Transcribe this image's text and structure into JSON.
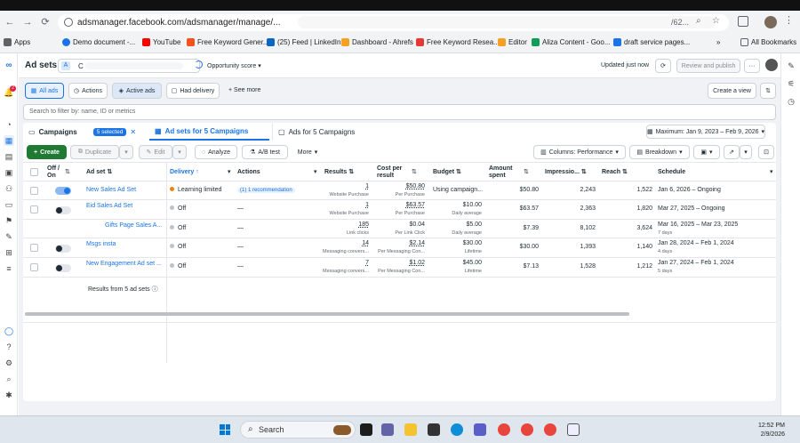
{
  "browser": {
    "url": "adsmanager.facebook.com/adsmanager/manage/...",
    "url_suffix": "/62...",
    "bookmarks": [
      {
        "label": "Apps",
        "color": "#5f6368"
      },
      {
        "label": "Demo document -...",
        "color": "#1a73e8"
      },
      {
        "label": "YouTube",
        "color": "#ff0000"
      },
      {
        "label": "Free Keyword Gener...",
        "color": "#f4511e"
      },
      {
        "label": "(25) Feed | LinkedIn",
        "color": "#0a66c2"
      },
      {
        "label": "Dashboard - Ahrefs",
        "color": "#f4a021"
      },
      {
        "label": "Free Keyword Resea...",
        "color": "#e53935"
      },
      {
        "label": "Editor",
        "color": "#f4a021"
      },
      {
        "label": "Aliza Content - Goo...",
        "color": "#0f9d58"
      },
      {
        "label": "draft service pages...",
        "color": "#1a73e8"
      }
    ],
    "all_bookmarks": "All Bookmarks"
  },
  "topbar": {
    "title": "Ad sets",
    "account_initial": "A",
    "account_name": "C",
    "opportunity_label": "Opportunity score",
    "updated": "Updated just now",
    "review_button": "Review and publish"
  },
  "viewbar": {
    "all_ads": "All ads",
    "actions": "Actions",
    "active_ads": "Active ads",
    "had_delivery": "Had delivery",
    "see_more": "See more",
    "create_view": "Create a view"
  },
  "search": {
    "placeholder": "Search to filter by: name, ID or metrics"
  },
  "tabs": {
    "campaigns": "Campaigns",
    "selected": "5 selected",
    "adsets": "Ad sets for 5 Campaigns",
    "ads": "Ads for 5 Campaigns",
    "date_range": "Maximum: Jan 9, 2023 – Feb 9, 2026"
  },
  "toolbar": {
    "create": "Create",
    "duplicate": "Duplicate",
    "edit": "Edit",
    "analyze": "Analyze",
    "ab_test": "A/B test",
    "more": "More",
    "columns": "Columns: Performance",
    "breakdown": "Breakdown"
  },
  "columns": {
    "offon_1": "Off /",
    "offon_2": "On",
    "adset": "Ad set",
    "delivery": "Delivery",
    "actions": "Actions",
    "results": "Results",
    "cpr_1": "Cost per",
    "cpr_2": "result",
    "budget": "Budget",
    "spent_1": "Amount",
    "spent_2": "spent",
    "impressions": "Impressio...",
    "reach": "Reach",
    "schedule": "Schedule"
  },
  "rows": [
    {
      "on": true,
      "name": "New Sales Ad Set",
      "delivery": "Learning limited",
      "delivery_color": "#e8860f",
      "actions": "(1) 1 recommendation",
      "results": "1",
      "results_sub": "Website Purchase",
      "cpr": "$50.80",
      "cpr_sub": "Per Purchase",
      "budget": "Using campaign...",
      "budget_sub": "",
      "spent": "$50.80",
      "impressions": "2,243",
      "reach": "1,522",
      "schedule": "Jan 6, 2026 – Ongoing",
      "schedule_sub": ""
    },
    {
      "on": false,
      "name": "Eid Sales Ad Set",
      "delivery": "Off",
      "delivery_color": "#bec3c9",
      "actions": "—",
      "results": "1",
      "results_sub": "Website Purchase",
      "cpr": "$63.57",
      "cpr_sub": "Per Purchase",
      "budget": "$10.00",
      "budget_sub": "Daily average",
      "spent": "$63.57",
      "impressions": "2,363",
      "reach": "1,820",
      "schedule": "Mar 27, 2025 – Ongoing",
      "schedule_sub": ""
    },
    {
      "on": null,
      "name": "Gifts Page Sales A...",
      "delivery": "Off",
      "delivery_color": "#bec3c9",
      "actions": "—",
      "results": "185",
      "results_sub": "Link clicks",
      "cpr": "$0.04",
      "cpr_sub": "Per Link Click",
      "budget": "$5.00",
      "budget_sub": "Daily average",
      "spent": "$7.39",
      "impressions": "8,102",
      "reach": "3,624",
      "schedule": "Mar 16, 2025 – Mar 23, 2025",
      "schedule_sub": "7 days"
    },
    {
      "on": false,
      "name": "Msgs insta",
      "delivery": "Off",
      "delivery_color": "#bec3c9",
      "actions": "—",
      "results": "14",
      "results_sub": "Messaging convers...",
      "cpr": "$2.14",
      "cpr_sub": "Per Messaging Con...",
      "budget": "$30.00",
      "budget_sub": "Lifetime",
      "spent": "$30.00",
      "impressions": "1,393",
      "reach": "1,140",
      "schedule": "Jan 28, 2024 – Feb 1, 2024",
      "schedule_sub": "4 days"
    },
    {
      "on": false,
      "name": "New Engagement Ad set ...",
      "delivery": "Off",
      "delivery_color": "#bec3c9",
      "actions": "—",
      "results": "7",
      "results_sub": "Messaging convers...",
      "cpr": "$1.02",
      "cpr_sub": "Per Messaging Con...",
      "budget": "$45.00",
      "budget_sub": "Lifetime",
      "spent": "$7.13",
      "impressions": "1,528",
      "reach": "1,212",
      "schedule": "Jan 27, 2024 – Feb 1, 2024",
      "schedule_sub": "5 days"
    }
  ],
  "footer": {
    "results_text": "Results from 5 ad sets"
  },
  "taskbar": {
    "search": "Search",
    "time": "12:52 PM",
    "date": "2/9/2026"
  },
  "colors": {
    "accent": "#1b74e4",
    "create": "#1f7a33"
  }
}
